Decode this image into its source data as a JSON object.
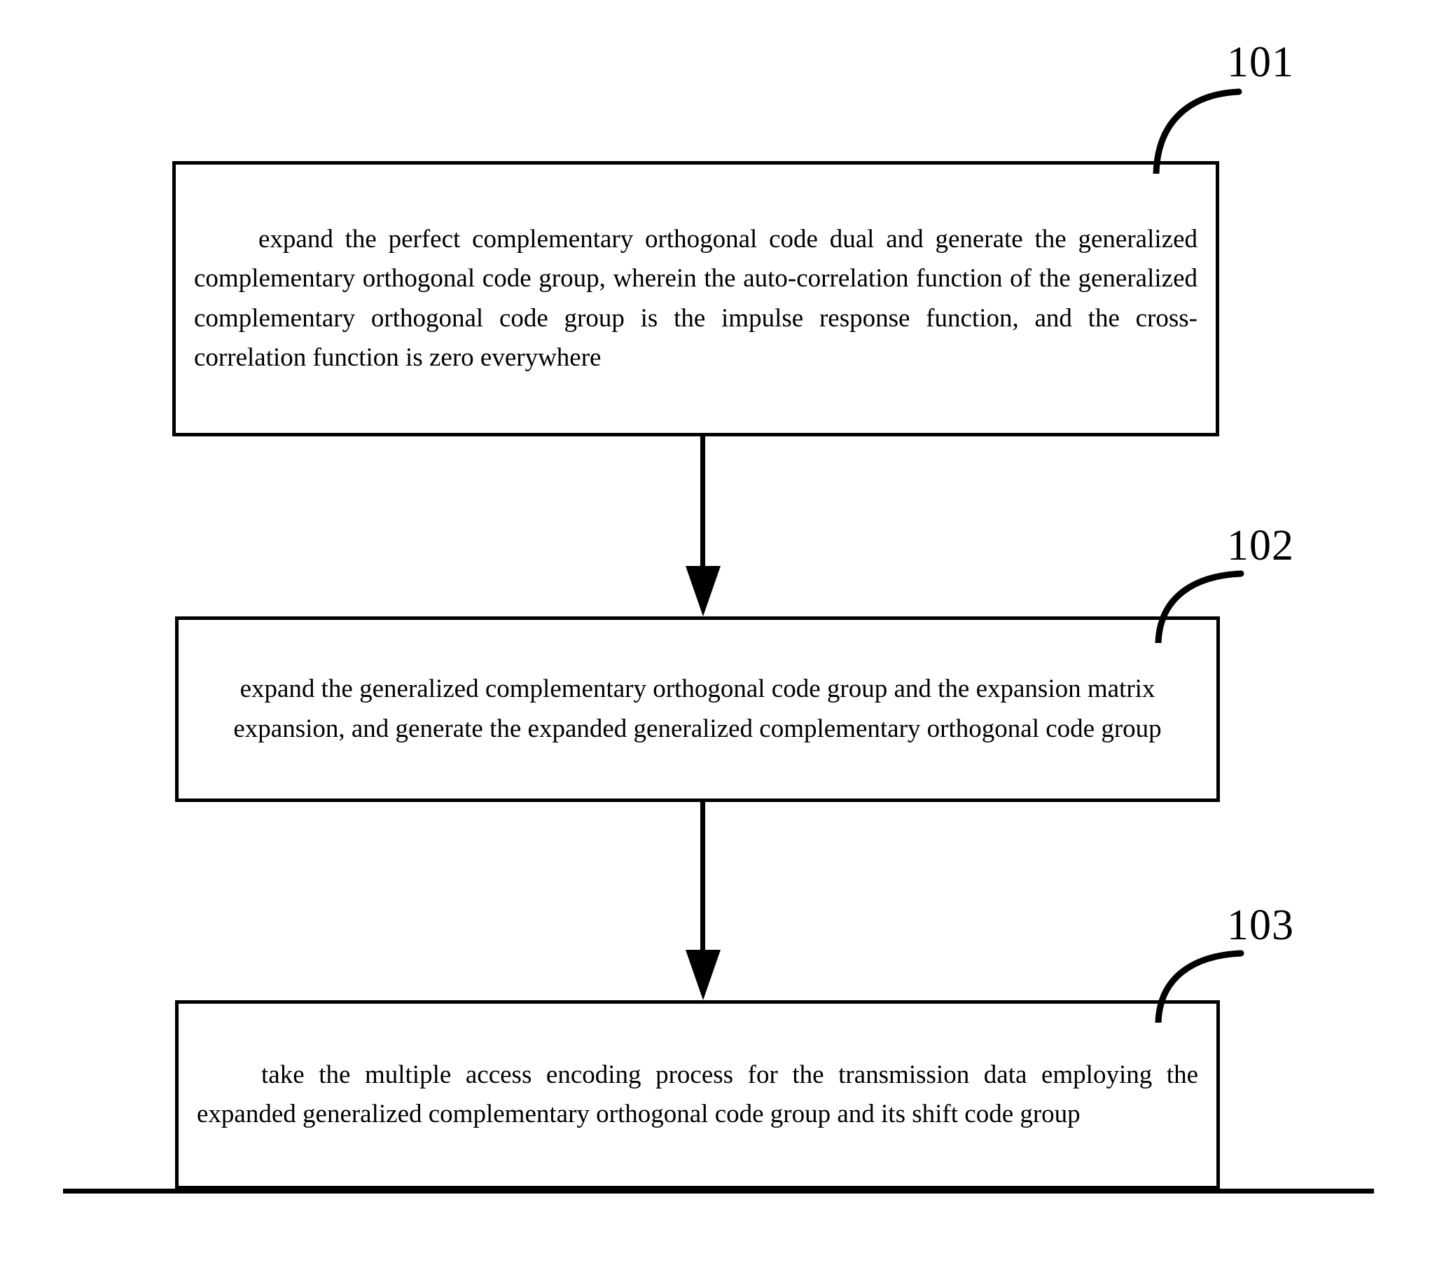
{
  "figure": {
    "type": "patent-flowchart",
    "orientation": "vertical",
    "background_color": "#ffffff",
    "line_color": "#000000"
  },
  "nodes": [
    {
      "ref": "101",
      "text": "expand the perfect complementary orthogonal code dual and generate the generalized complementary orthogonal code group, wherein the auto-correlation function of the generalized complementary orthogonal code group is the impulse response function, and the cross-correlation function is zero everywhere",
      "align": "justify"
    },
    {
      "ref": "102",
      "text": "expand the generalized complementary orthogonal code group and the expansion matrix expansion, and generate the expanded generalized complementary orthogonal code group",
      "align": "center"
    },
    {
      "ref": "103",
      "text": "take the multiple access encoding process for the transmission data employing the expanded generalized complementary orthogonal code group and its shift code group",
      "align": "justify"
    }
  ],
  "refs": {
    "n101": "101",
    "n102": "102",
    "n103": "103"
  },
  "connectors": [
    {
      "name": "arrow-101-to-102",
      "from": "101",
      "to": "102",
      "style": "solid-filled-arrowhead",
      "direction": "down"
    },
    {
      "name": "arrow-102-to-103",
      "from": "102",
      "to": "103",
      "style": "solid-filled-arrowhead",
      "direction": "down"
    }
  ]
}
